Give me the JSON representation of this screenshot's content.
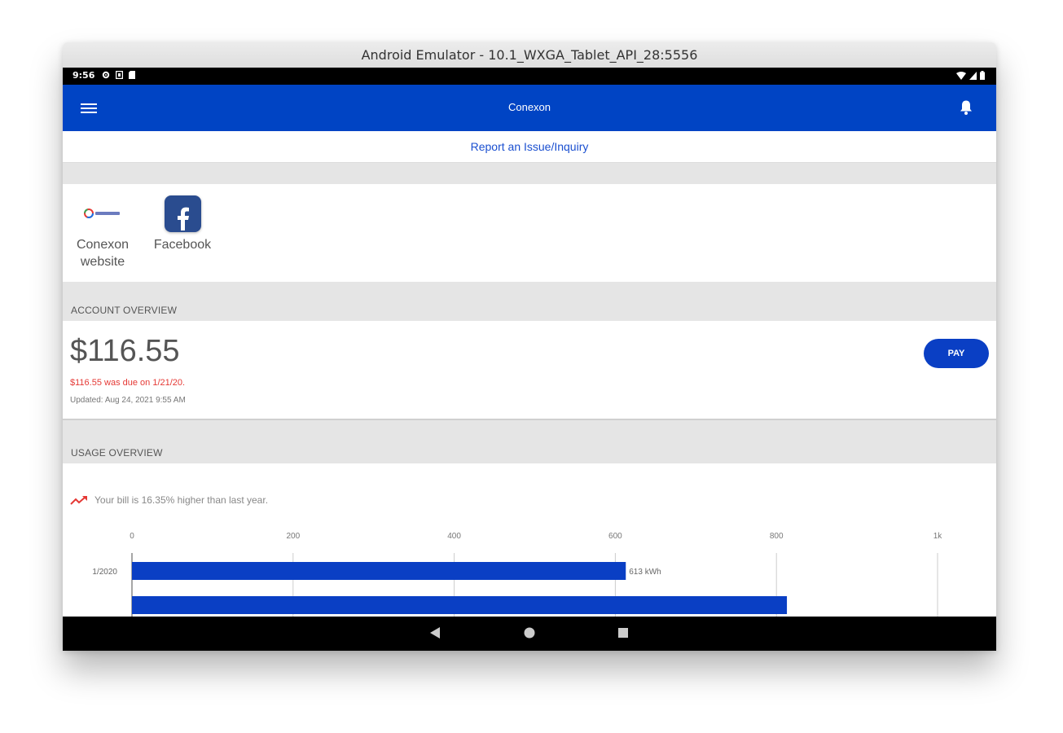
{
  "window": {
    "title": "Android Emulator - 10.1_WXGA_Tablet_API_28:5556"
  },
  "statusbar": {
    "time": "9:56",
    "icons": [
      "settings-icon",
      "sd-card-icon",
      "clipboard-icon"
    ],
    "right_icons": [
      "wifi-icon",
      "signal-icon",
      "battery-icon"
    ]
  },
  "appbar": {
    "title": "Conexon",
    "menu_icon": "hamburger-menu-icon",
    "bell_icon": "notification-bell-icon"
  },
  "report_link": "Report an Issue/Inquiry",
  "links": [
    {
      "label_line1": "Conexon",
      "label_line2": "website",
      "icon": "conexon-logo"
    },
    {
      "label": "Facebook",
      "icon": "facebook-icon"
    }
  ],
  "account": {
    "header": "ACCOUNT OVERVIEW",
    "amount": "$116.55",
    "due_text": "$116.55 was due on 1/21/20.",
    "updated": "Updated: Aug 24, 2021 9:55 AM",
    "pay_label": "PAY"
  },
  "usage": {
    "header": "USAGE OVERVIEW",
    "trend_text": "Your bill is 16.35% higher than last year.",
    "trend_color": "#e53935"
  },
  "chart_data": {
    "type": "bar",
    "orientation": "horizontal",
    "categories": [
      "1/2020",
      ""
    ],
    "values": [
      613,
      813
    ],
    "value_labels": [
      "613 kWh",
      ""
    ],
    "xlim": [
      0,
      1000
    ],
    "xticks": [
      "0",
      "200",
      "400",
      "600",
      "800",
      "1k"
    ],
    "bar_color": "#0a3fc4",
    "grid": true
  },
  "navbar": {
    "back": "back-icon",
    "home": "home-icon",
    "recents": "recents-icon"
  },
  "colors": {
    "primary": "#0044c4",
    "button": "#0a3fc4",
    "link": "#1a4fd0",
    "error": "#e53935"
  }
}
